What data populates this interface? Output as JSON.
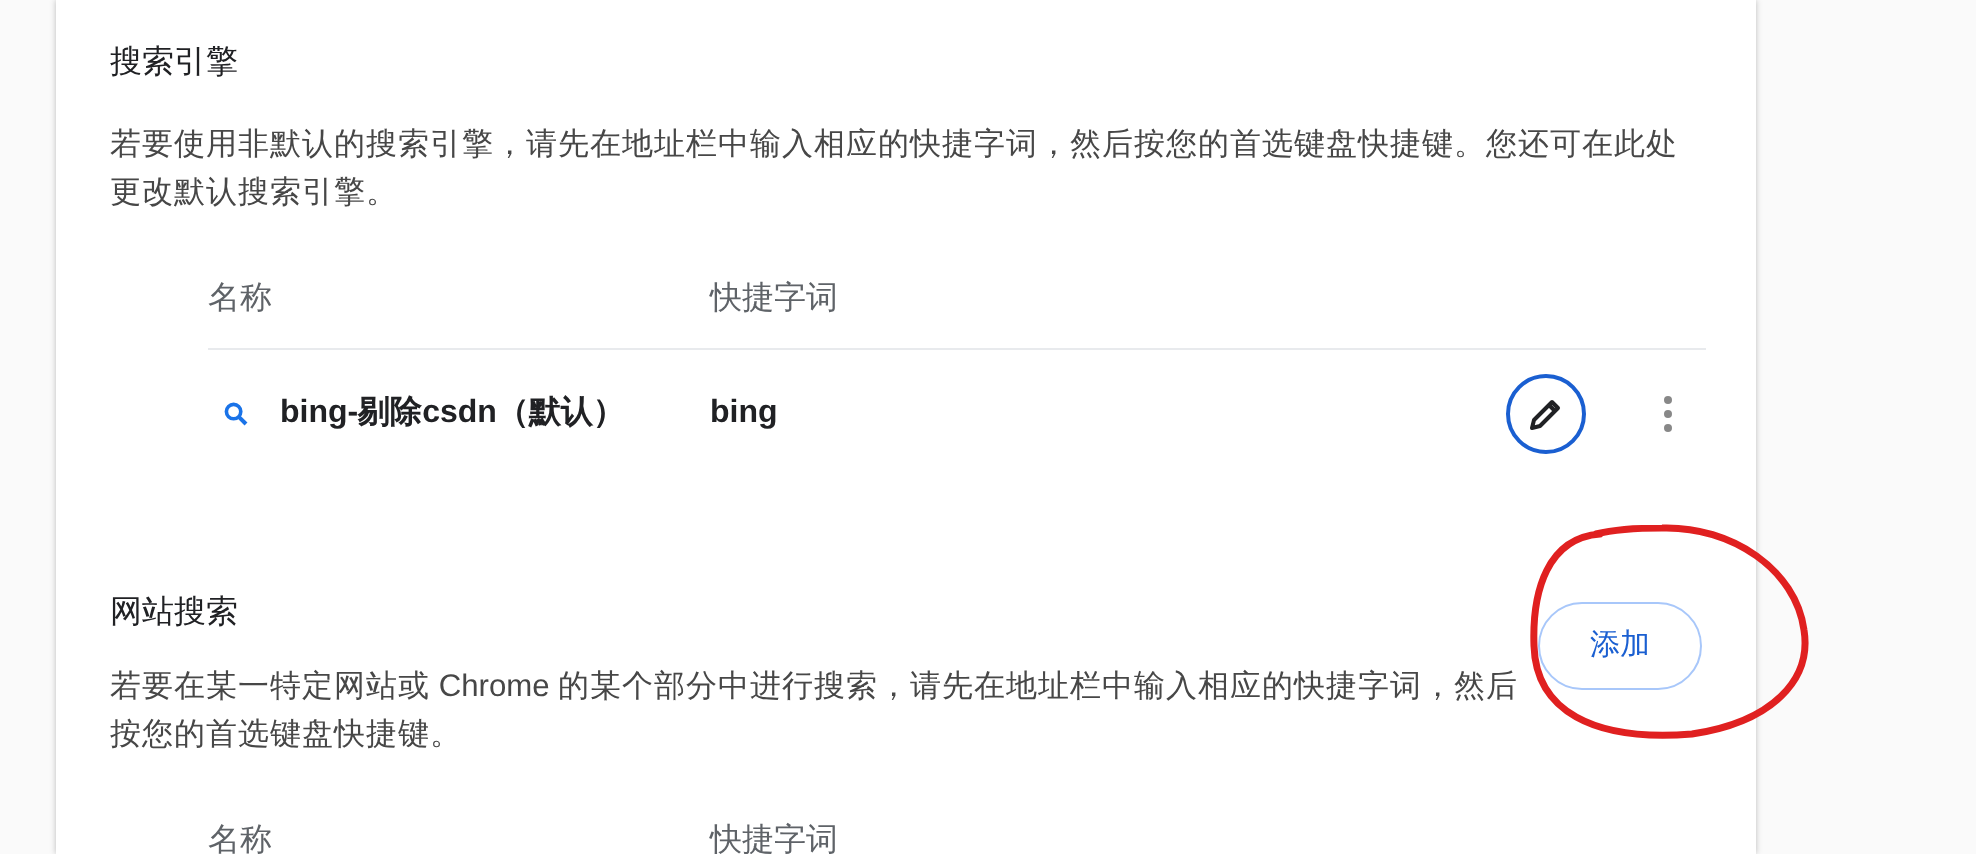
{
  "sections": [
    {
      "title": "搜索引擎",
      "description": "若要使用非默认的搜索引擎，请先在地址栏中输入相应的快捷字词，然后按您的首选键盘快捷键。您还可在此处更改默认搜索引擎。",
      "columns": [
        "名称",
        "快捷字词"
      ],
      "rows": [
        {
          "name": "bing-剔除csdn（默认）",
          "keyword": "bing"
        }
      ]
    },
    {
      "title": "网站搜索",
      "description": "若要在某一特定网站或 Chrome 的某个部分中进行搜索，请先在地址栏中输入相应的快捷字词，然后按您的首选键盘快捷键。",
      "button": "添加",
      "columns": [
        "名称",
        "快捷字词"
      ]
    }
  ],
  "annotation": {
    "kind": "loop",
    "color": "#e02020"
  }
}
